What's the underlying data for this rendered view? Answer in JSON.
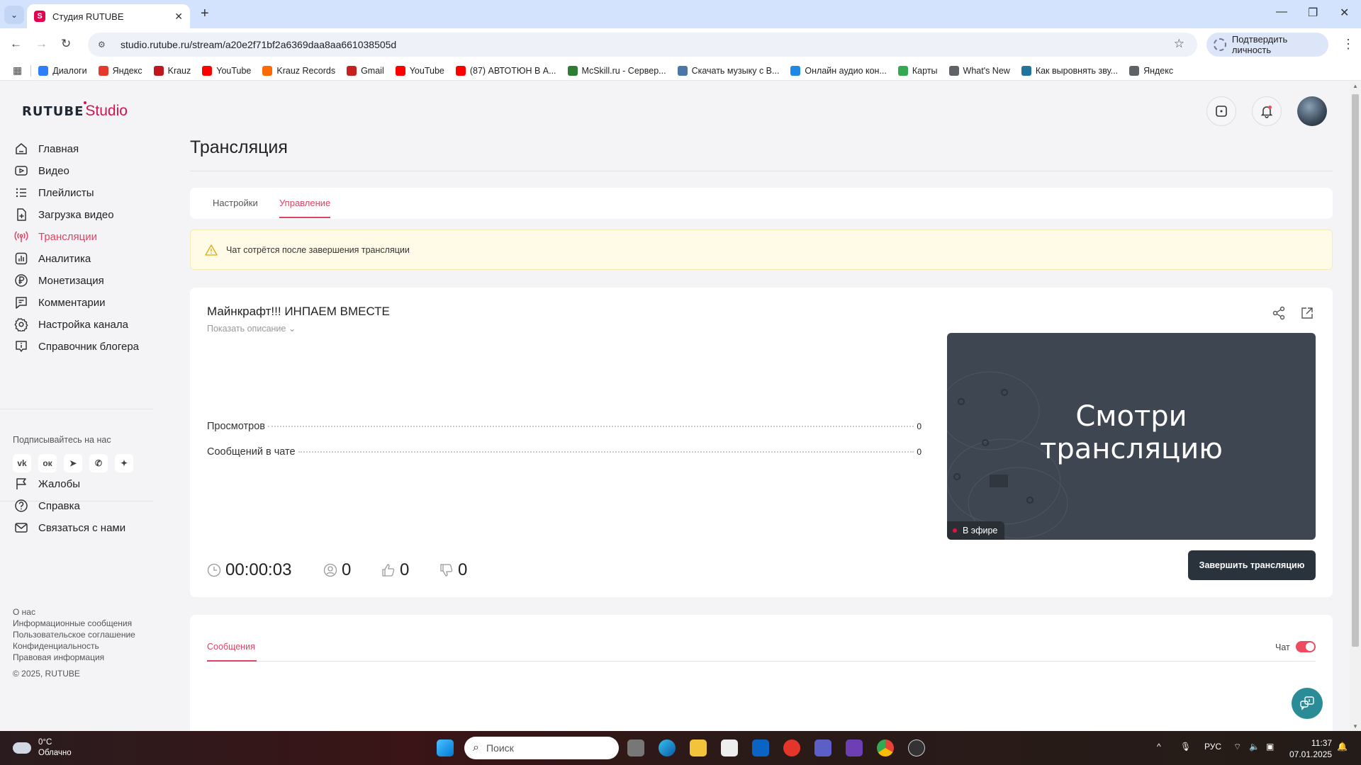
{
  "browser": {
    "tab_title": "Студия RUTUBE",
    "tab_favicon": "S",
    "url": "studio.rutube.ru/stream/a20e2f71bf2a6369daa8aa661038505d",
    "verify_label": "Подтвердить личность",
    "bookmarks": [
      {
        "label": "Диалоги",
        "icon": "chat-icon",
        "color": "#2d7ff9"
      },
      {
        "label": "Яндекс",
        "icon": "yandex-icon",
        "color": "#e53a2b"
      },
      {
        "label": "Krauz",
        "icon": "krauz-icon",
        "color": "#c0161d"
      },
      {
        "label": "YouTube",
        "icon": "youtube-icon",
        "color": "#ff0000"
      },
      {
        "label": "Krauz Records",
        "icon": "soundcloud-icon",
        "color": "#ff6a00"
      },
      {
        "label": "Gmail",
        "icon": "gmail-icon",
        "color": "#c5221f"
      },
      {
        "label": "YouTube",
        "icon": "youtube-icon",
        "color": "#ff0000"
      },
      {
        "label": "(87) АВТОТЮН В А...",
        "icon": "youtube-icon",
        "color": "#ff0000"
      },
      {
        "label": "McSkill.ru - Сервер...",
        "icon": "mcskill-icon",
        "color": "#2e7d32"
      },
      {
        "label": "Скачать музыку с В...",
        "icon": "music-icon",
        "color": "#4a76a8"
      },
      {
        "label": "Онлайн аудио кон...",
        "icon": "audio-icon",
        "color": "#1e88e5"
      },
      {
        "label": "Карты",
        "icon": "maps-icon",
        "color": "#34a853"
      },
      {
        "label": "What's New",
        "icon": "chrome-icon",
        "color": "#5f6368"
      },
      {
        "label": "Как выровнять зву...",
        "icon": "wordpress-icon",
        "color": "#21759b"
      },
      {
        "label": "Яндекс",
        "icon": "globe-icon",
        "color": "#5f6368"
      }
    ]
  },
  "sidebar": {
    "logo_main": "RUTUBE",
    "logo_sub": "Studio",
    "items": [
      {
        "label": "Главная",
        "icon": "home-icon"
      },
      {
        "label": "Видео",
        "icon": "video-icon"
      },
      {
        "label": "Плейлисты",
        "icon": "playlist-icon"
      },
      {
        "label": "Загрузка видео",
        "icon": "upload-icon"
      },
      {
        "label": "Трансляции",
        "icon": "broadcast-icon",
        "active": true
      },
      {
        "label": "Аналитика",
        "icon": "analytics-icon"
      },
      {
        "label": "Монетизация",
        "icon": "ruble-icon"
      },
      {
        "label": "Комментарии",
        "icon": "comment-icon"
      },
      {
        "label": "Настройка канала",
        "icon": "gear-icon"
      },
      {
        "label": "Справочник блогера",
        "icon": "info-icon"
      }
    ],
    "subscribe_label": "Подписывайтесь на нас",
    "social": [
      "vk-icon",
      "ok-icon",
      "telegram-icon",
      "viber-icon",
      "sparkle-icon"
    ],
    "bottom_items": [
      {
        "label": "Жалобы",
        "icon": "flag-icon"
      },
      {
        "label": "Справка",
        "icon": "help-icon"
      },
      {
        "label": "Связаться с нами",
        "icon": "mail-icon"
      }
    ],
    "footer_links": [
      "О нас",
      "Информационные сообщения",
      "Пользовательское соглашение",
      "Конфиденциальность",
      "Правовая информация"
    ],
    "copyright": "© 2025, RUTUBE"
  },
  "page": {
    "title": "Трансляция",
    "tabs": [
      {
        "label": "Настройки",
        "active": false
      },
      {
        "label": "Управление",
        "active": true
      }
    ],
    "alert": "Чат сотрётся после завершения трансляции",
    "stream": {
      "title": "Майнкрафт!!! ИНПАЕМ ВМЕСТЕ",
      "show_description": "Показать описание",
      "stats": [
        {
          "label": "Просмотров",
          "value": "0"
        },
        {
          "label": "Сообщений в чате",
          "value": "0"
        }
      ],
      "duration": "00:00:03",
      "viewers": "0",
      "likes": "0",
      "dislikes": "0",
      "player_text_line1": "Смотри",
      "player_text_line2": "трансляцию",
      "live_label": "В эфире",
      "end_button": "Завершить трансляцию"
    },
    "chat": {
      "tab_label": "Сообщения",
      "toggle_label": "Чат",
      "toggle_on": true
    }
  },
  "taskbar": {
    "temperature": "0°C",
    "weather": "Облачно",
    "search_placeholder": "Поиск",
    "language": "РУС",
    "time": "11:37",
    "date": "07.01.2025"
  },
  "colors": {
    "accent": "#dd4463",
    "brand": "#d4124e",
    "dark_button": "#2a323c",
    "alert_bg": "#fffbe6",
    "fab": "#2a8c96"
  }
}
